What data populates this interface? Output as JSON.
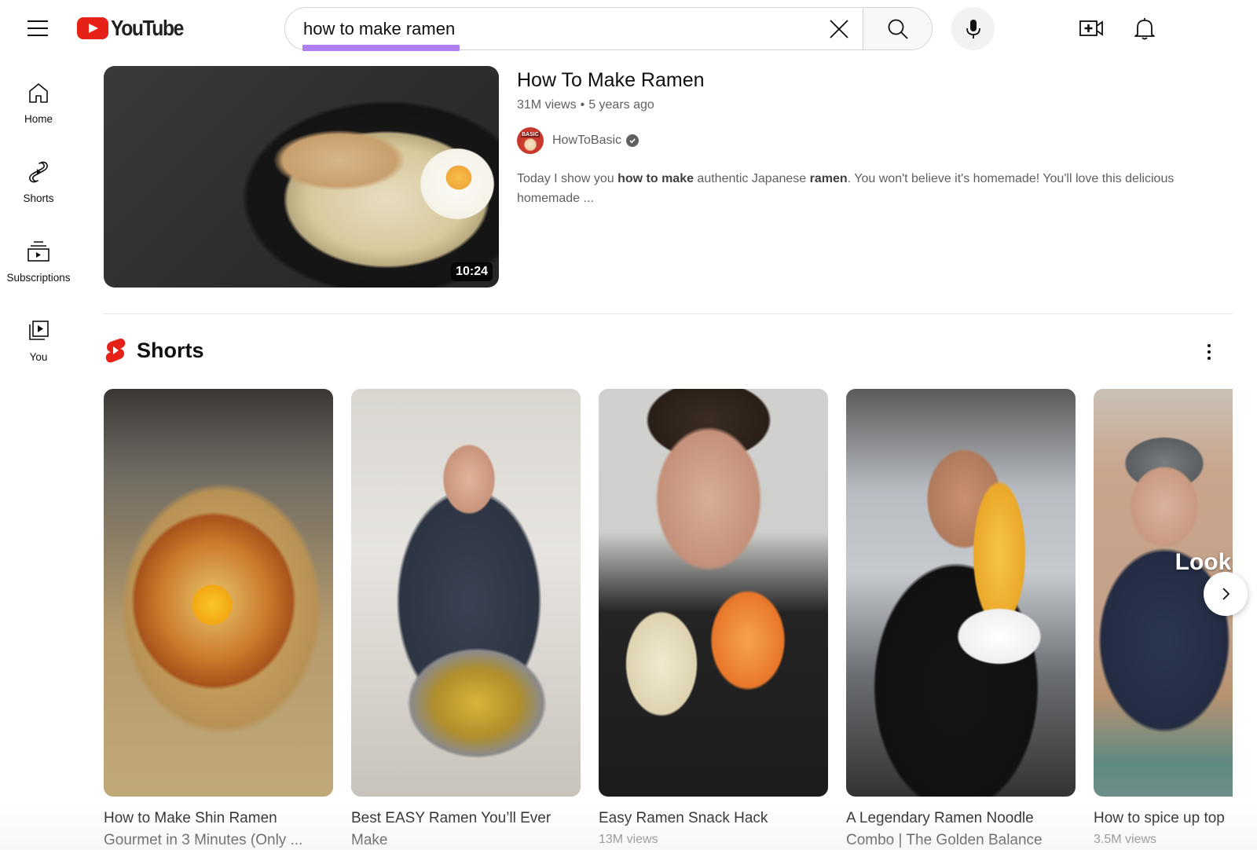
{
  "header": {
    "menu_icon": "hamburger-menu-icon",
    "logo_text": "YouTube",
    "search": {
      "value": "how to make ramen",
      "clear_icon": "close-icon",
      "search_icon": "search-icon",
      "highlight_color": "#b07ef3"
    },
    "mic_icon": "microphone-icon",
    "create_icon": "video-add-icon",
    "notifications_icon": "bell-icon"
  },
  "sidebar": {
    "items": [
      {
        "label": "Home",
        "icon": "home-icon"
      },
      {
        "label": "Shorts",
        "icon": "shorts-icon"
      },
      {
        "label": "Subscriptions",
        "icon": "subscriptions-icon"
      },
      {
        "label": "You",
        "icon": "library-icon"
      }
    ]
  },
  "main_result": {
    "title": "How To Make Ramen",
    "views": "31M views",
    "separator": "•",
    "age": "5 years ago",
    "duration": "10:24",
    "channel": {
      "name": "HowToBasic",
      "verified": true
    },
    "description": {
      "p1": "Today I show you ",
      "b1": "how to make",
      "p2": " authentic Japanese ",
      "b2": "ramen",
      "p3": ". You won't believe it's homemade! You'll love this delicious homemade ..."
    }
  },
  "shorts_shelf": {
    "title": "Shorts",
    "brand_color": "#e62117",
    "items": [
      {
        "title": "How to Make Shin Ramen Gourmet in 3 Minutes (Only ...",
        "views": ""
      },
      {
        "title": "Best EASY Ramen You’ll Ever Make",
        "views": ""
      },
      {
        "title": "Easy Ramen Snack Hack",
        "views": "13M views"
      },
      {
        "title": "A Legendary Ramen Noodle Combo | The Golden Balance",
        "views": ""
      },
      {
        "title": "How to spice up top",
        "views": "3.5M views",
        "overlay_text": "Looks L"
      }
    ],
    "more_icon": "more-vertical-icon",
    "next_icon": "chevron-right-icon"
  }
}
